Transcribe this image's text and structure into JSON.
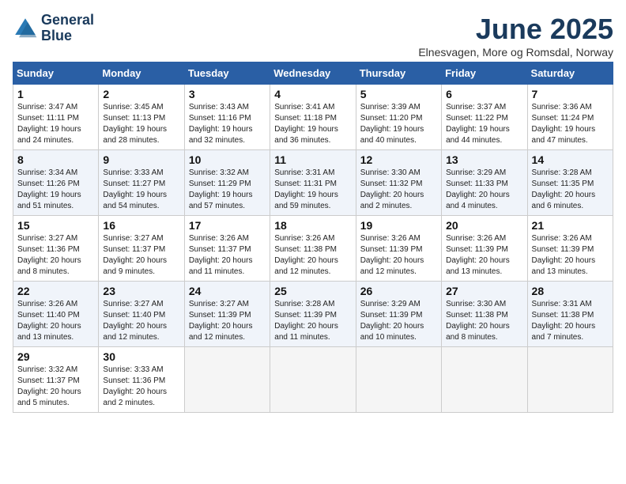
{
  "header": {
    "logo_line1": "General",
    "logo_line2": "Blue",
    "month_year": "June 2025",
    "location": "Elnesvagen, More og Romsdal, Norway"
  },
  "weekdays": [
    "Sunday",
    "Monday",
    "Tuesday",
    "Wednesday",
    "Thursday",
    "Friday",
    "Saturday"
  ],
  "weeks": [
    [
      {
        "day": "1",
        "rise": "Sunrise: 3:47 AM",
        "set": "Sunset: 11:11 PM",
        "daylight": "Daylight: 19 hours and 24 minutes."
      },
      {
        "day": "2",
        "rise": "Sunrise: 3:45 AM",
        "set": "Sunset: 11:13 PM",
        "daylight": "Daylight: 19 hours and 28 minutes."
      },
      {
        "day": "3",
        "rise": "Sunrise: 3:43 AM",
        "set": "Sunset: 11:16 PM",
        "daylight": "Daylight: 19 hours and 32 minutes."
      },
      {
        "day": "4",
        "rise": "Sunrise: 3:41 AM",
        "set": "Sunset: 11:18 PM",
        "daylight": "Daylight: 19 hours and 36 minutes."
      },
      {
        "day": "5",
        "rise": "Sunrise: 3:39 AM",
        "set": "Sunset: 11:20 PM",
        "daylight": "Daylight: 19 hours and 40 minutes."
      },
      {
        "day": "6",
        "rise": "Sunrise: 3:37 AM",
        "set": "Sunset: 11:22 PM",
        "daylight": "Daylight: 19 hours and 44 minutes."
      },
      {
        "day": "7",
        "rise": "Sunrise: 3:36 AM",
        "set": "Sunset: 11:24 PM",
        "daylight": "Daylight: 19 hours and 47 minutes."
      }
    ],
    [
      {
        "day": "8",
        "rise": "Sunrise: 3:34 AM",
        "set": "Sunset: 11:26 PM",
        "daylight": "Daylight: 19 hours and 51 minutes."
      },
      {
        "day": "9",
        "rise": "Sunrise: 3:33 AM",
        "set": "Sunset: 11:27 PM",
        "daylight": "Daylight: 19 hours and 54 minutes."
      },
      {
        "day": "10",
        "rise": "Sunrise: 3:32 AM",
        "set": "Sunset: 11:29 PM",
        "daylight": "Daylight: 19 hours and 57 minutes."
      },
      {
        "day": "11",
        "rise": "Sunrise: 3:31 AM",
        "set": "Sunset: 11:31 PM",
        "daylight": "Daylight: 19 hours and 59 minutes."
      },
      {
        "day": "12",
        "rise": "Sunrise: 3:30 AM",
        "set": "Sunset: 11:32 PM",
        "daylight": "Daylight: 20 hours and 2 minutes."
      },
      {
        "day": "13",
        "rise": "Sunrise: 3:29 AM",
        "set": "Sunset: 11:33 PM",
        "daylight": "Daylight: 20 hours and 4 minutes."
      },
      {
        "day": "14",
        "rise": "Sunrise: 3:28 AM",
        "set": "Sunset: 11:35 PM",
        "daylight": "Daylight: 20 hours and 6 minutes."
      }
    ],
    [
      {
        "day": "15",
        "rise": "Sunrise: 3:27 AM",
        "set": "Sunset: 11:36 PM",
        "daylight": "Daylight: 20 hours and 8 minutes."
      },
      {
        "day": "16",
        "rise": "Sunrise: 3:27 AM",
        "set": "Sunset: 11:37 PM",
        "daylight": "Daylight: 20 hours and 9 minutes."
      },
      {
        "day": "17",
        "rise": "Sunrise: 3:26 AM",
        "set": "Sunset: 11:37 PM",
        "daylight": "Daylight: 20 hours and 11 minutes."
      },
      {
        "day": "18",
        "rise": "Sunrise: 3:26 AM",
        "set": "Sunset: 11:38 PM",
        "daylight": "Daylight: 20 hours and 12 minutes."
      },
      {
        "day": "19",
        "rise": "Sunrise: 3:26 AM",
        "set": "Sunset: 11:39 PM",
        "daylight": "Daylight: 20 hours and 12 minutes."
      },
      {
        "day": "20",
        "rise": "Sunrise: 3:26 AM",
        "set": "Sunset: 11:39 PM",
        "daylight": "Daylight: 20 hours and 13 minutes."
      },
      {
        "day": "21",
        "rise": "Sunrise: 3:26 AM",
        "set": "Sunset: 11:39 PM",
        "daylight": "Daylight: 20 hours and 13 minutes."
      }
    ],
    [
      {
        "day": "22",
        "rise": "Sunrise: 3:26 AM",
        "set": "Sunset: 11:40 PM",
        "daylight": "Daylight: 20 hours and 13 minutes."
      },
      {
        "day": "23",
        "rise": "Sunrise: 3:27 AM",
        "set": "Sunset: 11:40 PM",
        "daylight": "Daylight: 20 hours and 12 minutes."
      },
      {
        "day": "24",
        "rise": "Sunrise: 3:27 AM",
        "set": "Sunset: 11:39 PM",
        "daylight": "Daylight: 20 hours and 12 minutes."
      },
      {
        "day": "25",
        "rise": "Sunrise: 3:28 AM",
        "set": "Sunset: 11:39 PM",
        "daylight": "Daylight: 20 hours and 11 minutes."
      },
      {
        "day": "26",
        "rise": "Sunrise: 3:29 AM",
        "set": "Sunset: 11:39 PM",
        "daylight": "Daylight: 20 hours and 10 minutes."
      },
      {
        "day": "27",
        "rise": "Sunrise: 3:30 AM",
        "set": "Sunset: 11:38 PM",
        "daylight": "Daylight: 20 hours and 8 minutes."
      },
      {
        "day": "28",
        "rise": "Sunrise: 3:31 AM",
        "set": "Sunset: 11:38 PM",
        "daylight": "Daylight: 20 hours and 7 minutes."
      }
    ],
    [
      {
        "day": "29",
        "rise": "Sunrise: 3:32 AM",
        "set": "Sunset: 11:37 PM",
        "daylight": "Daylight: 20 hours and 5 minutes."
      },
      {
        "day": "30",
        "rise": "Sunrise: 3:33 AM",
        "set": "Sunset: 11:36 PM",
        "daylight": "Daylight: 20 hours and 2 minutes."
      },
      null,
      null,
      null,
      null,
      null
    ]
  ]
}
